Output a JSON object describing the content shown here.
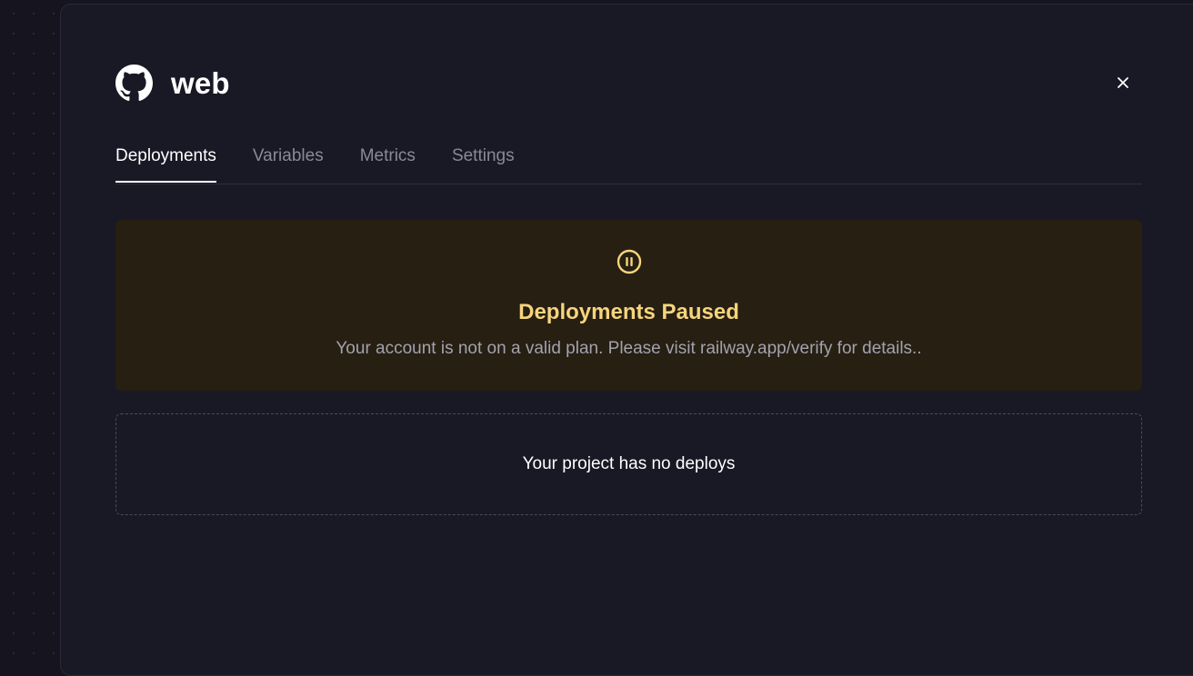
{
  "service": {
    "name": "web",
    "icon": "github-icon"
  },
  "close": {
    "icon": "close-icon"
  },
  "tabs": [
    {
      "label": "Deployments",
      "active": true
    },
    {
      "label": "Variables",
      "active": false
    },
    {
      "label": "Metrics",
      "active": false
    },
    {
      "label": "Settings",
      "active": false
    }
  ],
  "banner": {
    "icon": "pause-circle-icon",
    "title": "Deployments Paused",
    "message": "Your account is not on a valid plan. Please visit railway.app/verify for details..",
    "accent_color": "#f7d47d",
    "background_color": "#261f12"
  },
  "deploys": {
    "empty_message": "Your project has no deploys"
  }
}
